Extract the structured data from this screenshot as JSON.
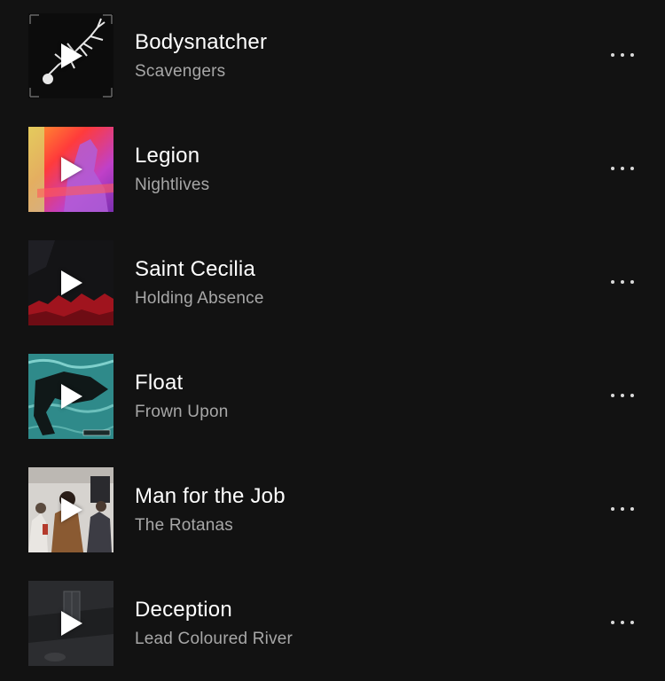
{
  "colors": {
    "background": "#121212",
    "title_text": "#ffffff",
    "artist_text": "#a7a7a7"
  },
  "tracks": [
    {
      "title": "Bodysnatcher",
      "artist": "Scavengers",
      "art_icon": "skeleton-artwork",
      "play_icon": "play-icon",
      "menu_icon": "more-options-icon"
    },
    {
      "title": "Legion",
      "artist": "Nightlives",
      "art_icon": "singer-artwork",
      "play_icon": "play-icon",
      "menu_icon": "more-options-icon"
    },
    {
      "title": "Saint Cecilia",
      "artist": "Holding Absence",
      "art_icon": "dark-red-artwork",
      "play_icon": "play-icon",
      "menu_icon": "more-options-icon"
    },
    {
      "title": "Float",
      "artist": "Frown Upon",
      "art_icon": "water-artwork",
      "play_icon": "play-icon",
      "menu_icon": "more-options-icon"
    },
    {
      "title": "Man for the Job",
      "artist": "The Rotanas",
      "art_icon": "band-photo-artwork",
      "play_icon": "play-icon",
      "menu_icon": "more-options-icon"
    },
    {
      "title": "Deception",
      "artist": "Lead Coloured River",
      "art_icon": "dark-room-artwork",
      "play_icon": "play-icon",
      "menu_icon": "more-options-icon"
    }
  ]
}
